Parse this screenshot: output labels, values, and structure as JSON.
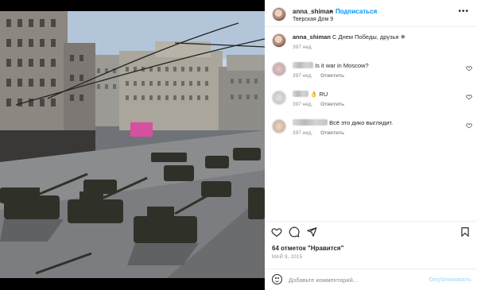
{
  "header": {
    "username": "anna_shiman",
    "dot": "•",
    "follow_label": "Подписаться",
    "location": "Тверская Дом 9",
    "more_icon": "more-horizontal-icon"
  },
  "caption": {
    "username": "anna_shiman",
    "text": "С Днем Победы, друзья",
    "emoji": "✵",
    "time": "397 нед."
  },
  "comments": [
    {
      "username_hidden": true,
      "text": "Is it war in Moscow?",
      "time": "397 нед.",
      "reply": "Ответить"
    },
    {
      "username_hidden": true,
      "text": "👌 RU",
      "time": "397 нед.",
      "reply": "Ответить"
    },
    {
      "username_hidden": true,
      "text": "Всё это дико выглядит.",
      "time": "397 нед.",
      "reply": "Ответить"
    }
  ],
  "actions": {
    "likes": "64 отметок \"Нравится\"",
    "date": "МАЙ 9, 2015"
  },
  "add_comment": {
    "placeholder": "Добавьте комментарий...",
    "post_label": "Опубликовать"
  },
  "colors": {
    "accent": "#0095f6",
    "post_disabled": "#b2dffc",
    "muted": "#8e8e8e",
    "text": "#262626"
  }
}
